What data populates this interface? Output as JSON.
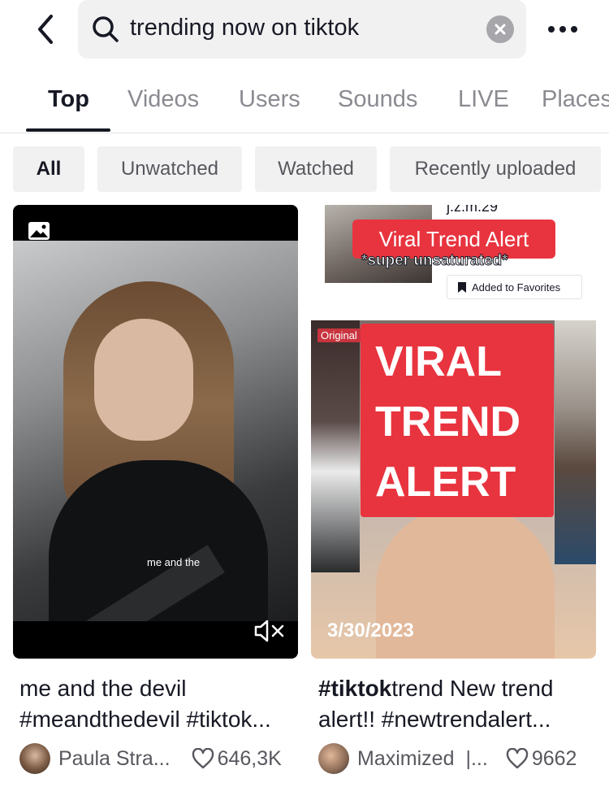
{
  "search": {
    "query": "trending now on tiktok"
  },
  "icons": {
    "back": "chevron-left-icon",
    "search": "search-icon",
    "clear": "close-circle-icon",
    "more": "more-horizontal-icon",
    "photo": "image-icon",
    "mute": "mute-icon",
    "bookmark": "bookmark-icon",
    "heart": "heart-outline-icon"
  },
  "tabs": [
    {
      "label": "Top"
    },
    {
      "label": "Videos"
    },
    {
      "label": "Users"
    },
    {
      "label": "Sounds"
    },
    {
      "label": "LIVE"
    },
    {
      "label": "Places"
    }
  ],
  "filters": [
    {
      "label": "All"
    },
    {
      "label": "Unwatched"
    },
    {
      "label": "Watched"
    },
    {
      "label": "Recently uploaded"
    }
  ],
  "results": [
    {
      "overlay_text": "me and the",
      "caption_line1": "me and the devil",
      "caption_line2": "#meandthedevil #tiktok",
      "author": "Paula Stra...",
      "likes": "646,3K"
    },
    {
      "username_tag": "j.z.m.29",
      "banner_small": "Viral Trend Alert",
      "banner_sub": "*super unsaturated*",
      "favorites_chip": "Added to Favorites",
      "original_tag": "Original",
      "banner_big": "VIRAL\nTREND\nALERT",
      "date": "3/30/2023",
      "caption_bold": "#tiktok",
      "caption_rest": "trend New trend",
      "caption_line2": "alert!! #newtrendalert",
      "author": "Maximized",
      "author_suffix": "|...",
      "likes": "9662"
    }
  ],
  "colors": {
    "accent": "#e8343f",
    "text": "#161823",
    "muted": "#8a8b91",
    "chip_bg": "#f1f1f2"
  }
}
